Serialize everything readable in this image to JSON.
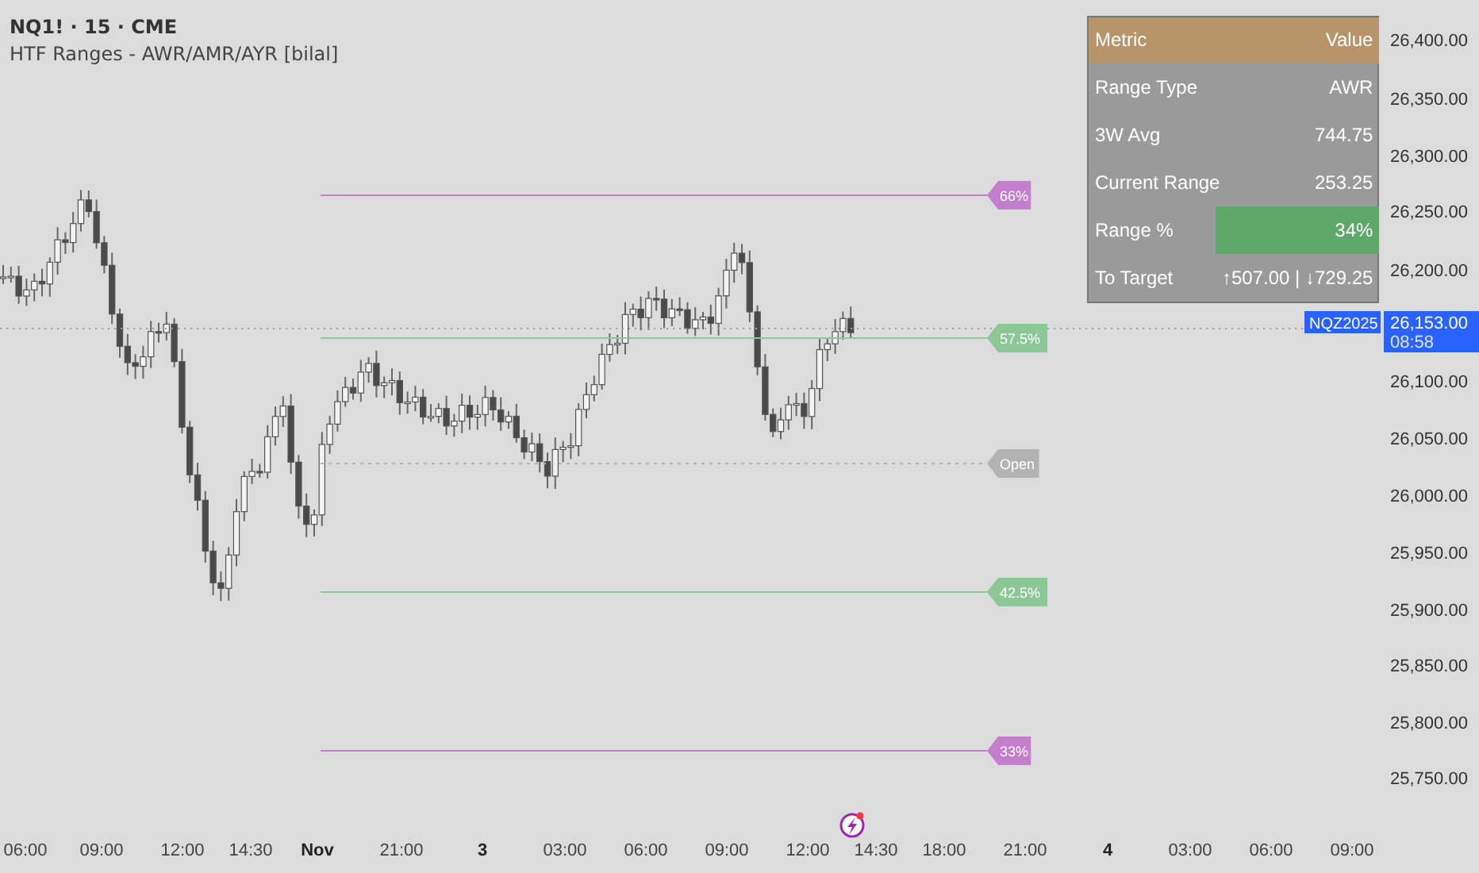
{
  "legend": {
    "title": "NQ1! · 15 · CME",
    "indicator": "HTF Ranges - AWR/AMR/AYR [bilal]"
  },
  "table": {
    "columns": [
      "Metric",
      "Value"
    ],
    "rows": [
      {
        "metric": "Range Type",
        "value": "AWR",
        "highlighted": false
      },
      {
        "metric": "3W Avg",
        "value": "744.75",
        "highlighted": false
      },
      {
        "metric": "Current Range",
        "value": "253.25",
        "highlighted": false
      },
      {
        "metric": "Range %",
        "value": "34%",
        "highlighted": true
      },
      {
        "metric": "To Target",
        "value": "↑507.00 | ↓729.25",
        "highlighted": false
      }
    ]
  },
  "levels": [
    {
      "label": "66%",
      "color": "#c47fcc",
      "kind": "solid"
    },
    {
      "label": "57.5%",
      "color": "#8cc796",
      "kind": "solid"
    },
    {
      "label": "Open",
      "color": "#b3b3b3",
      "kind": "dotted"
    },
    {
      "label": "42.5%",
      "color": "#8cc796",
      "kind": "solid"
    },
    {
      "label": "33%",
      "color": "#c47fcc",
      "kind": "solid"
    }
  ],
  "current_price": {
    "symbol": "NQZ2025",
    "price": "26,153.00",
    "countdown": "08:58"
  },
  "price_axis": {
    "ticks": [
      "26,400.00",
      "26,350.00",
      "26,300.00",
      "26,250.00",
      "26,200.00",
      "26,100.00",
      "26,050.00",
      "26,000.00",
      "25,950.00",
      "25,900.00",
      "25,850.00",
      "25,800.00",
      "25,750.00"
    ]
  },
  "time_axis": {
    "labels": [
      {
        "text": "06:00",
        "day_start": false
      },
      {
        "text": "09:00",
        "day_start": false
      },
      {
        "text": "12:00",
        "day_start": false
      },
      {
        "text": "14:30",
        "day_start": false
      },
      {
        "text": "Nov",
        "day_start": true
      },
      {
        "text": "21:00",
        "day_start": false
      },
      {
        "text": "3",
        "day_start": true
      },
      {
        "text": "03:00",
        "day_start": false
      },
      {
        "text": "06:00",
        "day_start": false
      },
      {
        "text": "09:00",
        "day_start": false
      },
      {
        "text": "12:00",
        "day_start": false
      },
      {
        "text": "14:30",
        "day_start": false
      },
      {
        "text": "18:00",
        "day_start": false
      },
      {
        "text": "21:00",
        "day_start": false
      },
      {
        "text": "4",
        "day_start": true
      },
      {
        "text": "03:00",
        "day_start": false
      },
      {
        "text": "06:00",
        "day_start": false
      },
      {
        "text": "09:00",
        "day_start": false
      }
    ]
  }
}
